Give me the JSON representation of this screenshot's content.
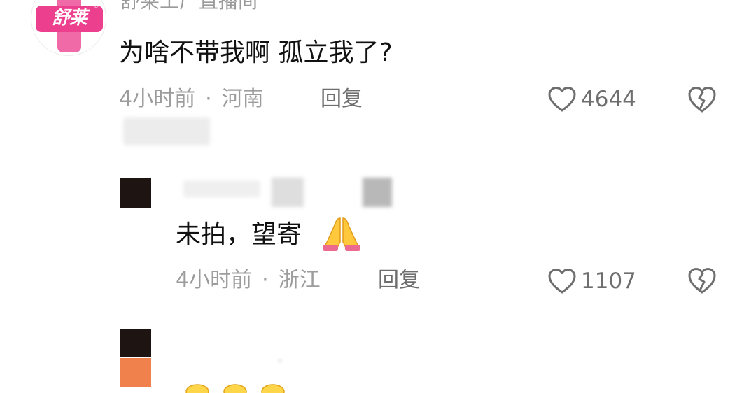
{
  "comments": [
    {
      "avatar_brand": "舒莱",
      "avatar_reg": "®",
      "username": "舒莱工厂直播间",
      "text": "为啥不带我啊 孤立我了?",
      "time": "4小时前",
      "location": "河南",
      "reply_label": "回复",
      "likes": "4644"
    },
    {
      "text": "未拍，望寄",
      "emoji": "folded-hands",
      "time": "4小时前",
      "location": "浙江",
      "reply_label": "回复",
      "likes": "1107"
    }
  ],
  "separator": "·",
  "colors": {
    "brand_pink": "#ec3f8e",
    "text_primary": "#111111",
    "text_meta": "#9c9c9c"
  },
  "icons": [
    "heart-outline-icon",
    "broken-heart-icon",
    "folded-hands-emoji"
  ]
}
